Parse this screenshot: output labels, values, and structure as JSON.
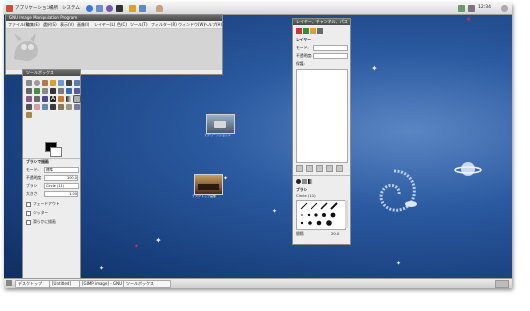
{
  "top_panel": {
    "apps_menu": "アプリケーション",
    "places_menu": "場所",
    "system_menu": "システム",
    "clock": "12:34"
  },
  "gimp_main": {
    "title": "GNU Image Manipulation Program",
    "menu": [
      "ファイル(F)",
      "編集(E)",
      "選択(S)",
      "表示(V)",
      "画像(I)",
      "レイヤー(L)",
      "色(C)",
      "ツール(T)",
      "フィルター(R)",
      "ウィンドウ(W)",
      "ヘルプ(H)"
    ]
  },
  "toolbox": {
    "title": "ツールボックス",
    "options_title": "ブラシで描画",
    "mode_label": "モード:",
    "mode_value": "標準",
    "opacity_label": "不透明度",
    "opacity_value": "100.0",
    "brush_label": "ブラシ",
    "brush_value": "Circle (11)",
    "size_label": "大きさ",
    "size_value": "1.00",
    "checkboxes": [
      "フェードアウト",
      "ジッター",
      "滑らかに描画"
    ]
  },
  "layers_dialog": {
    "title": "レイヤー、チャンネル、パス",
    "layers_tab": "レイヤー",
    "mode_label": "モード:",
    "opacity_label": "不透明度:",
    "lock_label": "保護:",
    "brushes_label": "ブラシ",
    "brush_name": "Circle (11)",
    "spacing_label": "間隔",
    "spacing_value": "20.0"
  },
  "desktop_icons": [
    {
      "label": "スクリーンショット"
    },
    {
      "label": "デスクトップ画像"
    }
  ],
  "taskbar": {
    "items": [
      "デスクトップ",
      "[Untitled]",
      "[GIMP image] - GNU Image",
      "ツールボックス"
    ]
  },
  "colors": {
    "desktop_dark": "#173d7a",
    "desktop_light": "#5b86c4",
    "panel": "#e2e2e2"
  }
}
